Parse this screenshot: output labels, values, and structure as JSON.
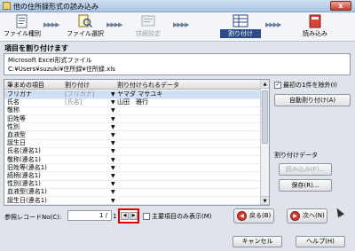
{
  "window": {
    "title": "他の住所録形式の読み込み",
    "close_label": "x"
  },
  "wizard": {
    "steps": [
      {
        "label": "ファイル種別"
      },
      {
        "label": "ファイル選択"
      },
      {
        "label": "詳細設定"
      },
      {
        "label": "割り付け"
      },
      {
        "label": "読み込み"
      }
    ],
    "arrow": "▶▶▶▶"
  },
  "heading": "項目を割り付けます",
  "file_info": {
    "type": "Microsoft Excel形式ファイル",
    "path": "C:¥Users¥suzuki¥住所録¥住所録.xls"
  },
  "grid": {
    "columns": [
      "筆まめの項目",
      "割り付け",
      "割り付けられるデータ"
    ],
    "rows": [
      {
        "field": "フリガナ",
        "assigned": "[フリガナ]",
        "data": "ヤマダ マサユキ"
      },
      {
        "field": "氏名",
        "assigned": "[氏名]",
        "data": "山田　雅行"
      },
      {
        "field": "敬称",
        "assigned": "",
        "data": ""
      },
      {
        "field": "旧姓等",
        "assigned": "",
        "data": ""
      },
      {
        "field": "性別",
        "assigned": "",
        "data": ""
      },
      {
        "field": "血液型",
        "assigned": "",
        "data": ""
      },
      {
        "field": "誕生日",
        "assigned": "",
        "data": ""
      },
      {
        "field": "氏名(連名1)",
        "assigned": "",
        "data": ""
      },
      {
        "field": "敬称(連名1)",
        "assigned": "",
        "data": ""
      },
      {
        "field": "旧姓等(連名1)",
        "assigned": "",
        "data": ""
      },
      {
        "field": "続柄(連名1)",
        "assigned": "",
        "data": ""
      },
      {
        "field": "性別(連名1)",
        "assigned": "",
        "data": ""
      },
      {
        "field": "血液型(連名1)",
        "assigned": "",
        "data": ""
      },
      {
        "field": "誕生日(連名1)",
        "assigned": "",
        "data": ""
      }
    ]
  },
  "side": {
    "exclude_first_row_label": "最初の1件を除外(I)",
    "auto_assign_label": "自動割り付け(A)",
    "group_label": "割り付けデータ",
    "load_label": "読み込み(F)...",
    "save_label": "保存(R)..."
  },
  "bottom": {
    "ref_label": "参照レコードNo(C):",
    "ref_value": "1 /",
    "ref_total": "1",
    "main_only_label": "主要項目のみ表示(M)",
    "back_label": "戻る(B)",
    "next_label": "次へ(N)",
    "cancel_label": "キャンセル",
    "help_label": "ヘルプ(H)"
  },
  "colors": {
    "highlight": "#e00000",
    "active_step": "#2b4a86",
    "nav_circle": "#d23a2c"
  }
}
